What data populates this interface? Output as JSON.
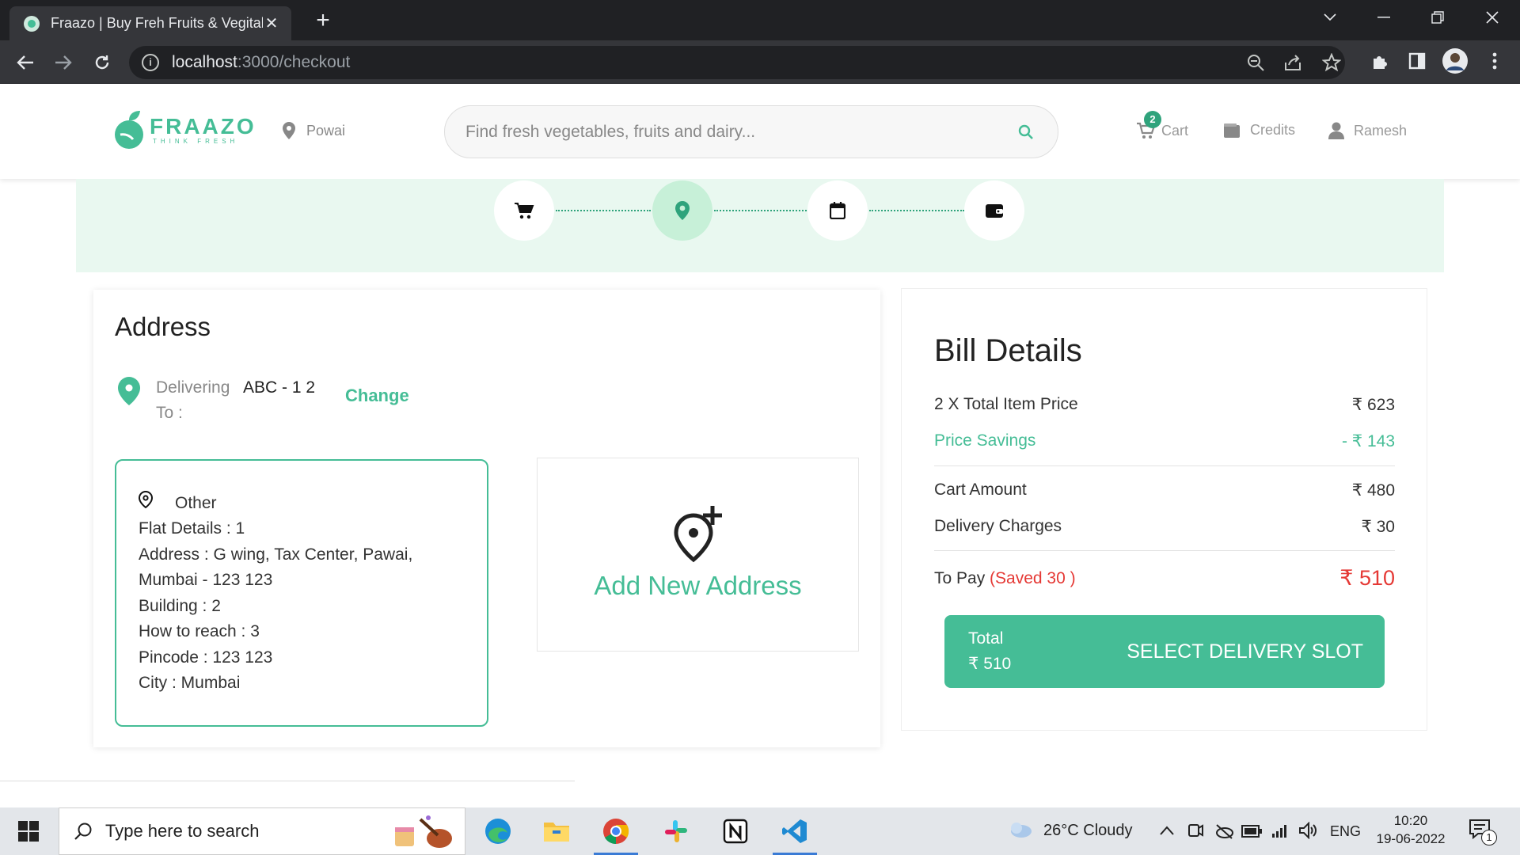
{
  "browser": {
    "tab_title": "Fraazo | Buy Freh Fruits & Vegitables",
    "url_host": "localhost",
    "url_path": ":3000/checkout"
  },
  "header": {
    "logo_text": "FRAAZO",
    "logo_tagline": "THINK FRESH",
    "location": "Powai",
    "search_placeholder": "Find fresh vegetables, fruits and dairy...",
    "cart_label": "Cart",
    "cart_count": "2",
    "credits_label": "Credits",
    "user_name": "Ramesh"
  },
  "address": {
    "title": "Address",
    "delivering_label": "Delivering To :",
    "delivering_value": "ABC - 1 2",
    "change_label": "Change",
    "selected": {
      "type": "Other",
      "lines": [
        "Flat Details : 1",
        "Address : G wing, Tax Center, Pawai, Mumbai - 123 123",
        "Building : 2",
        "How to reach : 3",
        "Pincode : 123 123",
        "City : Mumbai"
      ]
    },
    "add_new_label": "Add New Address"
  },
  "bill": {
    "title": "Bill Details",
    "item_price_label": "2 X Total Item Price",
    "item_price_value": "₹ 623",
    "savings_label": "Price Savings",
    "savings_value": "- ₹ 143",
    "cart_amount_label": "Cart Amount",
    "cart_amount_value": "₹ 480",
    "delivery_label": "Delivery Charges",
    "delivery_value": "₹ 30",
    "to_pay_label": "To Pay",
    "to_pay_saved": "(Saved 30 )",
    "to_pay_value": "₹ 510",
    "total_label": "Total",
    "total_value": "₹ 510",
    "cta_label": "SELECT DELIVERY SLOT"
  },
  "taskbar": {
    "search_placeholder": "Type here to search",
    "weather": "26°C  Cloudy",
    "language": "ENG",
    "time": "10:20",
    "date": "19-06-2022",
    "notification_count": "1"
  },
  "colors": {
    "brand_green": "#45bd96",
    "stepper_bg": "#e9f8f0",
    "alert_red": "#e53935"
  }
}
